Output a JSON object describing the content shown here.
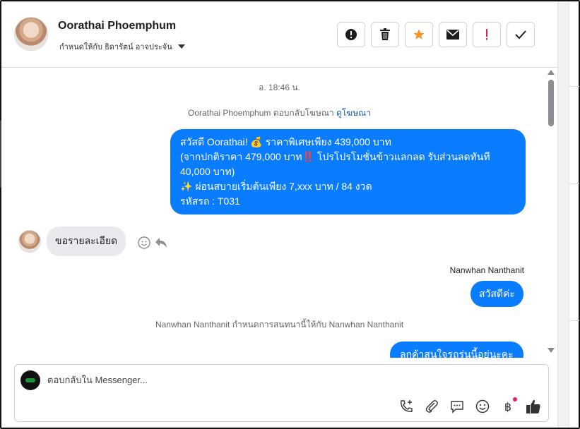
{
  "header": {
    "contact_name": "Oorathai Phoemphum",
    "assign_label": "กำหนดให้กับ ธิดารัตน์ อาจประจัน",
    "actions": [
      {
        "name": "report-spam",
        "icon": "exclamation-circle-icon"
      },
      {
        "name": "delete",
        "icon": "trash-icon"
      },
      {
        "name": "star",
        "icon": "star-icon",
        "color": "#f7931e"
      },
      {
        "name": "mark-unread",
        "icon": "envelope-icon"
      },
      {
        "name": "follow-up",
        "icon": "exclamation-icon",
        "color": "#e41e3f"
      },
      {
        "name": "mark-done",
        "icon": "check-icon"
      }
    ]
  },
  "chat": {
    "timestamp": "อ. 18:46 น.",
    "ad_reply_note": "Oorathai Phoemphum ตอบกลับโฆษณา",
    "ad_link": "ดูโฆษณา",
    "messages": {
      "promo_line1": "สวัสดี Oorathai! 💰 ราคาพิเศษเพียง 439,000 บาท",
      "promo_line2": "(จากปกติราคา 479,000 บาท‼️ โปรโปรโมชั่นข้าวแลกลด รับส่วนลดทันที",
      "promo_line3": "40,000 บาท)",
      "promo_line4": "✨ ผ่อนสบายเริ่มต้นเพียง 7,xxx บาท / 84 งวด",
      "promo_line5": " รหัสรถ : T031",
      "incoming_text": "ขอรายละเอียด",
      "agent_name": "Nanwhan Nanthanit",
      "greeting": "สวัสดีค่ะ",
      "assign_note": "Nanwhan Nanthanit กำหนดการสนทนานี้ให้กับ Nanwhan Nanthanit",
      "partial_text": "ลูกค้าสนใจรถรุ่นนี้อยู่นะคะ"
    }
  },
  "composer": {
    "placeholder": "ตอบกลับใน Messenger...",
    "tools": [
      "phone-plus-icon",
      "paperclip-icon",
      "speech-bubble-icon",
      "emoji-icon",
      "baht-icon",
      "thumbs-up-icon"
    ]
  },
  "colors": {
    "accent": "#0a7cff",
    "incoming_bubble": "#e9eaed",
    "link": "#1a5fb4"
  }
}
